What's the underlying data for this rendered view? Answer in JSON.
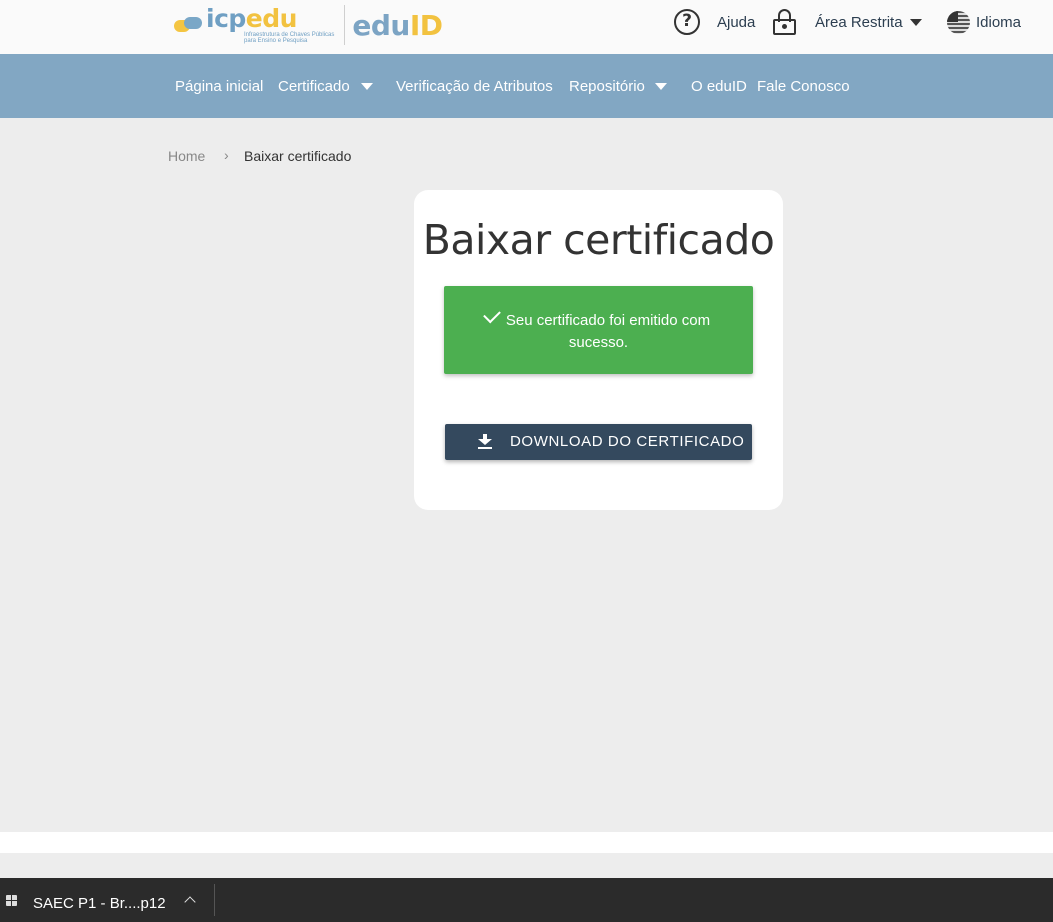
{
  "header": {
    "logo_icp": "icp",
    "logo_edu": "edu",
    "logo_subtitle_1": "Infraestrutura de Chaves Públicas",
    "logo_subtitle_2": "para Ensino e Pesquisa",
    "eduid_edu": "edu",
    "eduid_id": "ID",
    "help_label": "Ajuda",
    "restricted_label": "Área Restrita",
    "language_label": "Idioma",
    "help_glyph": "?"
  },
  "nav": {
    "items": [
      {
        "label": "Página inicial"
      },
      {
        "label": "Certificado"
      },
      {
        "label": "Verificação de Atributos"
      },
      {
        "label": "Repositório"
      },
      {
        "label": "O eduID"
      },
      {
        "label": "Fale Conosco"
      }
    ]
  },
  "breadcrumb": {
    "home": "Home",
    "separator": "›",
    "current": "Baixar certificado"
  },
  "card": {
    "title": "Baixar certificado",
    "success_message": "Seu certificado foi emitido com sucesso.",
    "download_button": "DOWNLOAD DO CERTIFICADO"
  },
  "taskbar": {
    "window_label": "SAEC P1 - Br....p12"
  },
  "colors": {
    "navbar": "#82a7c3",
    "success": "#4caf50",
    "button": "#34495e",
    "background": "#ededed",
    "taskbar": "#2b2b2b"
  },
  "icons": [
    "question-circle-icon",
    "lock-icon",
    "chevron-down-icon",
    "us-flag-icon",
    "check-icon",
    "download-icon",
    "app-grid-icon",
    "chevron-up-icon"
  ]
}
